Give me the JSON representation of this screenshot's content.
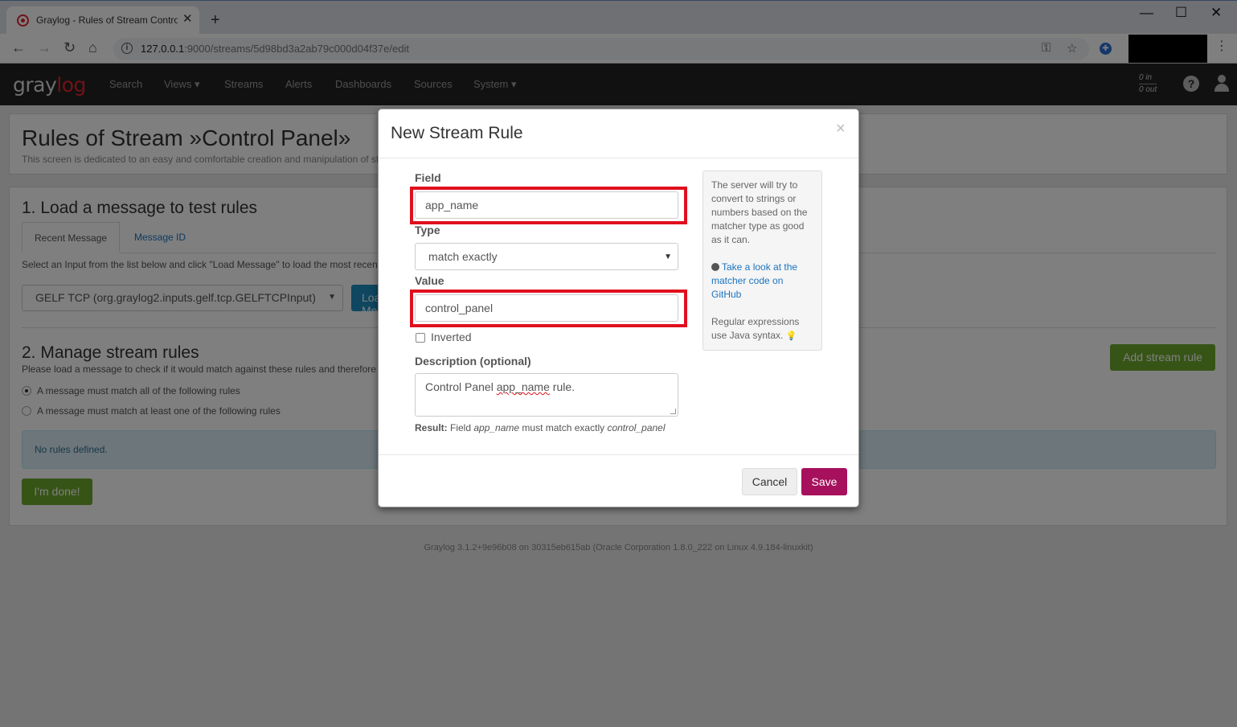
{
  "browser": {
    "tab_title": "Graylog - Rules of Stream Control Panel",
    "url_host": "127.0.0.1",
    "url_path": ":9000/streams/5d98bd3a2ab79c000d04f37e/edit"
  },
  "graylog_nav": {
    "logo_pre": "gray",
    "logo_post": "log",
    "items": [
      "Search",
      "Views ▾",
      "Streams",
      "Alerts",
      "Dashboards",
      "Sources",
      "System ▾"
    ],
    "throughput_in": "0 in",
    "throughput_out": "0 out"
  },
  "page": {
    "title": "Rules of Stream »Control Panel»",
    "description": "This screen is dedicated to an easy and comfortable creation and manipulation of stream rules. You can see the effect configured stream rules have on message matching here.",
    "section1_title": "1. Load a message to test rules",
    "tabs": [
      "Recent Message",
      "Message ID"
    ],
    "section1_help": "Select an Input from the list below and click \"Load Message\" to load the most recent message received by this input within the last hour.",
    "input_select": "GELF TCP (org.graylog2.inputs.gelf.tcp.GELFTCPInput)",
    "load_button": "Load Message",
    "section2_title": "2. Manage stream rules",
    "section2_help": "Please load a message to check if it would match against these rules and therefore be routed into this stream.",
    "radio_all": "A message must match all of the following rules",
    "radio_any": "A message must match at least one of the following rules",
    "add_rule_button": "Add stream rule",
    "no_rules": "No rules defined.",
    "done_button": "I'm done!",
    "footer": "Graylog 3.1.2+9e96b08 on 30315eb615ab (Oracle Corporation 1.8.0_222 on Linux 4.9.184-linuxkit)"
  },
  "modal": {
    "title": "New Stream Rule",
    "field_label": "Field",
    "field_value": "app_name",
    "type_label": "Type",
    "type_value": "match exactly",
    "value_label": "Value",
    "value_value": "control_panel",
    "inverted_label": "Inverted",
    "inverted_checked": false,
    "description_label": "Description (optional)",
    "description_pre": "Control Panel ",
    "description_spell": "app_name",
    "description_post": " rule.",
    "result_label": "Result:",
    "result_text_1": " Field ",
    "result_field": "app_name",
    "result_text_2": " must match exactly ",
    "result_value": "control_panel",
    "hint_1": "The server will try to convert to strings or numbers based on the matcher type as good as it can.",
    "hint_link": "Take a look at the matcher code on GitHub",
    "hint_2": "Regular expressions use Java syntax.",
    "cancel_button": "Cancel",
    "save_button": "Save"
  },
  "colors": {
    "highlight": "#e0101e",
    "save": "#a6105c",
    "success": "#6ea82e",
    "link": "#1a74c0"
  }
}
